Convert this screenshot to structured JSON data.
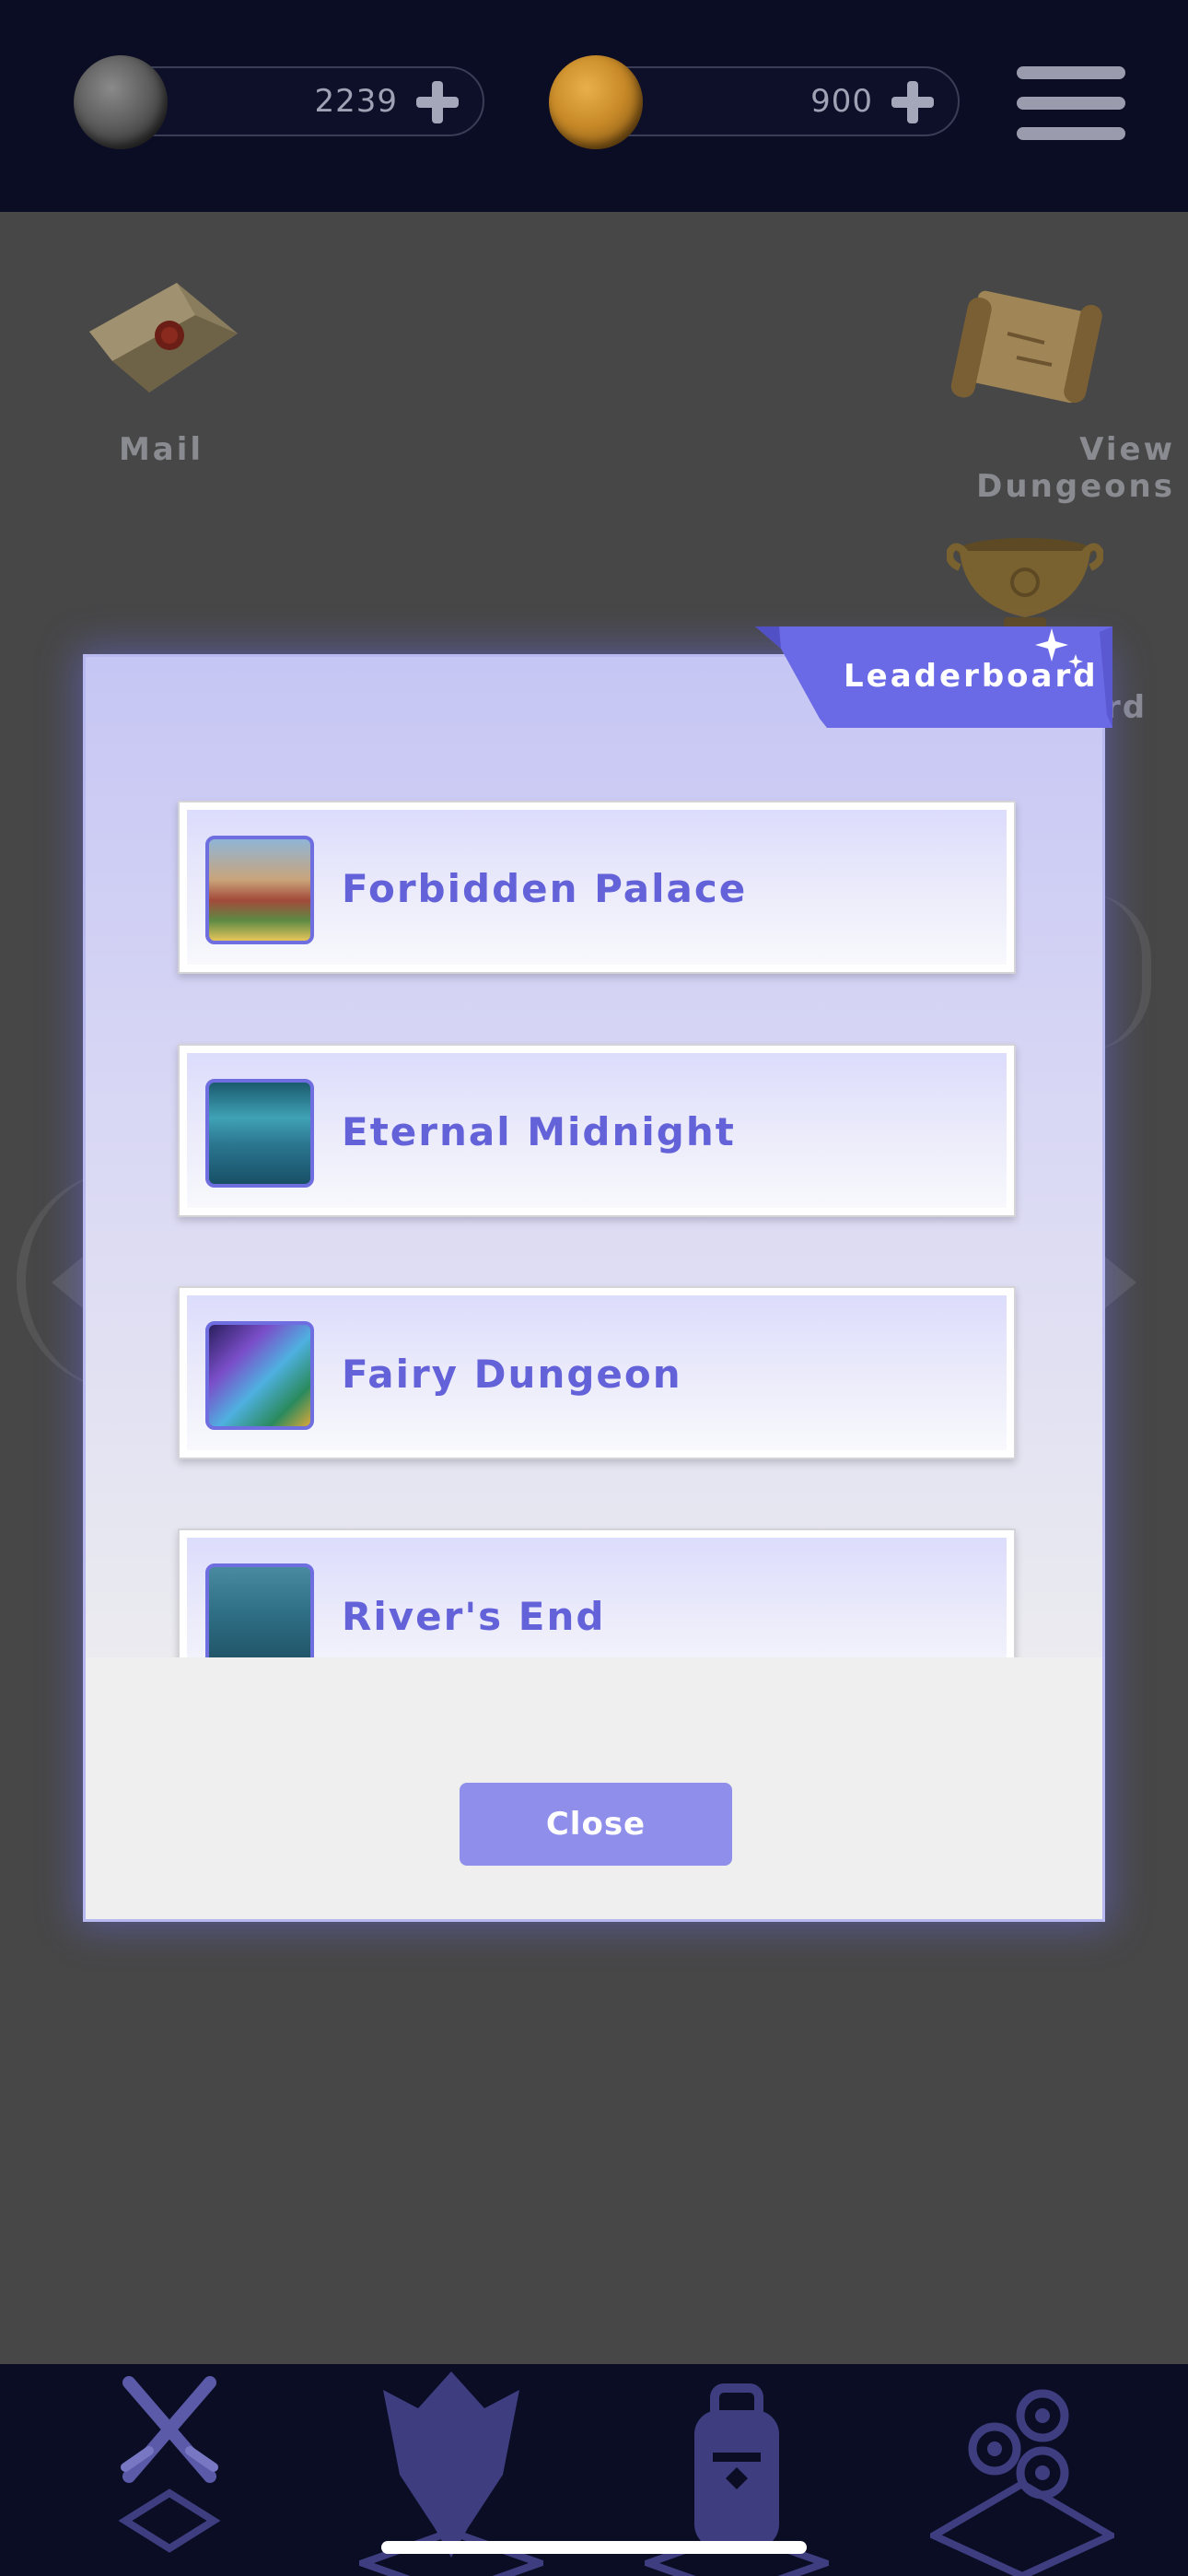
{
  "currencies": [
    {
      "name": "silver",
      "amount": "2239",
      "coin_icon": "silver-coin-icon",
      "add_icon": "plus-icon"
    },
    {
      "name": "gold",
      "amount": "900",
      "coin_icon": "gold-coin-icon",
      "add_icon": "plus-icon"
    }
  ],
  "menu": {
    "icon": "hamburger-menu-icon"
  },
  "background": {
    "mail_label": "Mail",
    "view_dungeons_label": "View Dungeons",
    "partial_label": "rd"
  },
  "modal": {
    "tab_label": "Leaderboard",
    "items": [
      {
        "label": "Forbidden Palace",
        "thumb": "forbidden-palace-thumbnail"
      },
      {
        "label": "Eternal Midnight",
        "thumb": "eternal-midnight-thumbnail"
      },
      {
        "label": "Fairy Dungeon",
        "thumb": "fairy-dungeon-thumbnail"
      },
      {
        "label": "River's End",
        "thumb": "rivers-end-thumbnail"
      }
    ],
    "close_label": "Close"
  },
  "bottom_nav": [
    {
      "name": "battle",
      "icon": "crossed-swords-icon",
      "active": true
    },
    {
      "name": "character",
      "icon": "character-icon",
      "active": false
    },
    {
      "name": "inventory",
      "icon": "backpack-icon",
      "active": false
    },
    {
      "name": "skills",
      "icon": "gears-icon",
      "active": false
    }
  ],
  "colors": {
    "accent": "#6462d9",
    "button": "#8f8eea",
    "ribbon": "#6b6ae6",
    "nav_icon": "#3e3d80",
    "topbar": "#0b0d24"
  }
}
